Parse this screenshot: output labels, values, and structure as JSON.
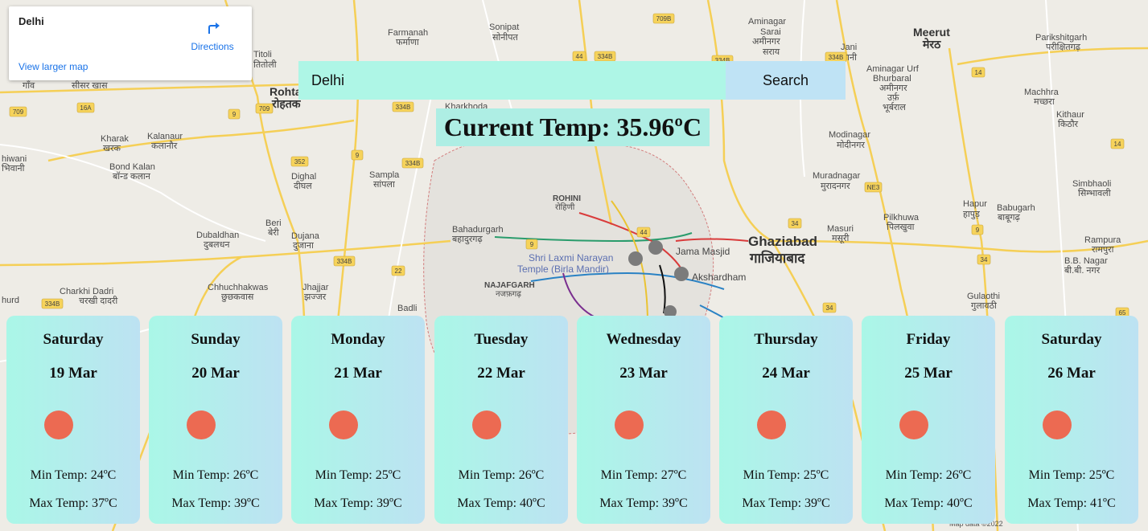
{
  "map": {
    "place_name": "Delhi",
    "directions_label": "Directions",
    "view_larger_label": "View larger map",
    "labels": {
      "rohtak": "Rohtak",
      "rohtak_hi": "रोहतक",
      "sampla": "Sampla",
      "sampla_hi": "सांपला",
      "farmanah": "Farmanah",
      "farmanah_hi": "फर्माणा",
      "sonipat": "Sonipat",
      "sonipat_hi": "सोनीपत",
      "meerut": "Meerut",
      "meerut_hi": "मेरठ",
      "ghaziabad": "Ghaziabad",
      "ghaziabad_hi": "गाजियाबाद",
      "bahadurgarh": "Bahadurgarh",
      "bahadurgarh_hi": "बहादुरगढ़",
      "jama_masjid": "Jama Masjid",
      "akshardham": "Akshardham",
      "laxmi_1": "Shri Laxmi Narayan",
      "laxmi_2": "Temple (Birla Mandir)",
      "rohini": "ROHINI",
      "rohini_hi": "रोहिणी",
      "najafgarh": "NAJAFGARH",
      "najafgarh_hi": "नजफ़गढ़",
      "modinagar": "Modinagar",
      "modinagar_hi": "मोदीनगर",
      "muradnagar": "Muradnagar",
      "muradnagar_hi": "मुरादनगर",
      "hapur": "Hapur",
      "hapur_hi": "हापुड़",
      "pilkhuwa": "Pilkhuwa",
      "pilkhuwa_hi": "पिलखुवा",
      "masuri": "Masuri",
      "masuri_hi": "मसूरी",
      "babugarh": "Babugarh",
      "babugarh_hi": "बाबूगढ़",
      "kharak": "Kharak",
      "kharak_hi": "खरक",
      "kalanaur": "Kalanaur",
      "kalanaur_hi": "कलानौर",
      "bond_kalan": "Bond Kalan",
      "bond_kalan_hi": "बॉन्ड कलान",
      "dighal": "Dighal",
      "dighal_hi": "दीघल",
      "beri": "Beri",
      "beri_hi": "बेरी",
      "dujana": "Dujana",
      "dujana_hi": "दुजाना",
      "dubaldhan": "Dubaldhan",
      "dubaldhan_hi": "दुबलधन",
      "chhuchhakwas": "Chhuchhakwas",
      "chhuchhakwas_hi": "छुछकवास",
      "jhajjar": "Jhajjar",
      "jhajjar_hi": "झज्जर",
      "charkhi_dadri": "Charkhi Dadri",
      "charkhi_dadri_hi": "चरखी दादरी",
      "titoli": "Titoli",
      "titoli_hi": "तितोली",
      "kharkhoda": "Kharkhoda",
      "parikshitgarh": "Parikshitgarh",
      "parikshitgarh_hi": "परीक्षितगढ़",
      "machhra": "Machhra",
      "machhra_hi": "मच्छरा",
      "kithaur": "Kithaur",
      "kithaur_hi": "किठौर",
      "simbhaoli": "Simbhaoli",
      "simbhaoli_hi": "सिम्भावली",
      "rampura": "Rampura",
      "rampura_hi": "रामपुरा",
      "bb_nagar": "B.B. Nagar",
      "bb_nagar_hi": "बी.बी. नगर",
      "gulaothi": "Gulaothi",
      "gulaothi_hi": "गुलावठी",
      "aminagar_sarai": "Aminagar",
      "aminagar_sarai_2": "Sarai",
      "aminagar_sarai_hi": "अमीनगर",
      "aminagar_sarai_hi2": "सराय",
      "aminagar_urf": "Aminagar Urf",
      "aminagar_urf_2": "Bhurbaral",
      "aminagar_urf_hi": "अमीनगर",
      "aminagar_urf_hi2": "उर्फ़",
      "aminagar_urf_hi3": "भूर्बराल",
      "jani": "Jani",
      "jani_hi": "जानी",
      "bhiwani": "hiwani",
      "bhiwani_hi": "भिवानी",
      "badli": "Badli",
      "hurd": "hurd",
      "siser_khas": "सीसर खास",
      "gaon": "गाँव",
      "footer": "Map data ©2022"
    },
    "shields": [
      "709",
      "709A",
      "9",
      "709",
      "16A",
      "352",
      "9",
      "334B",
      "334B",
      "709B",
      "44",
      "334B",
      "334B",
      "334B",
      "NE3",
      "34",
      "9",
      "14",
      "14",
      "334B",
      "22",
      "334B",
      "9",
      "44",
      "34",
      "34",
      "65"
    ]
  },
  "search": {
    "value": "Delhi",
    "button_label": "Search"
  },
  "current_temp": "Current Temp: 35.96ºC",
  "forecast": [
    {
      "day": "Saturday",
      "date": "19 Mar",
      "min": "Min Temp: 24ºC",
      "max": "Max Temp: 37ºC"
    },
    {
      "day": "Sunday",
      "date": "20 Mar",
      "min": "Min Temp: 26ºC",
      "max": "Max Temp: 39ºC"
    },
    {
      "day": "Monday",
      "date": "21 Mar",
      "min": "Min Temp: 25ºC",
      "max": "Max Temp: 39ºC"
    },
    {
      "day": "Tuesday",
      "date": "22 Mar",
      "min": "Min Temp: 26ºC",
      "max": "Max Temp: 40ºC"
    },
    {
      "day": "Wednesday",
      "date": "23 Mar",
      "min": "Min Temp: 27ºC",
      "max": "Max Temp: 39ºC"
    },
    {
      "day": "Thursday",
      "date": "24 Mar",
      "min": "Min Temp: 25ºC",
      "max": "Max Temp: 39ºC"
    },
    {
      "day": "Friday",
      "date": "25 Mar",
      "min": "Min Temp: 26ºC",
      "max": "Max Temp: 40ºC"
    },
    {
      "day": "Saturday",
      "date": "26 Mar",
      "min": "Min Temp: 25ºC",
      "max": "Max Temp: 41ºC"
    }
  ],
  "colors": {
    "sun_icon": "#ec6a52",
    "card_gradient_start": "#aaf7e7",
    "card_gradient_end": "#bde2f2",
    "search_input_bg": "#aef6e6",
    "search_button_bg": "#bfe3f5",
    "current_temp_bg": "#aeeee4"
  },
  "icons": {
    "forecast": "sun-icon",
    "directions": "directions-icon"
  }
}
